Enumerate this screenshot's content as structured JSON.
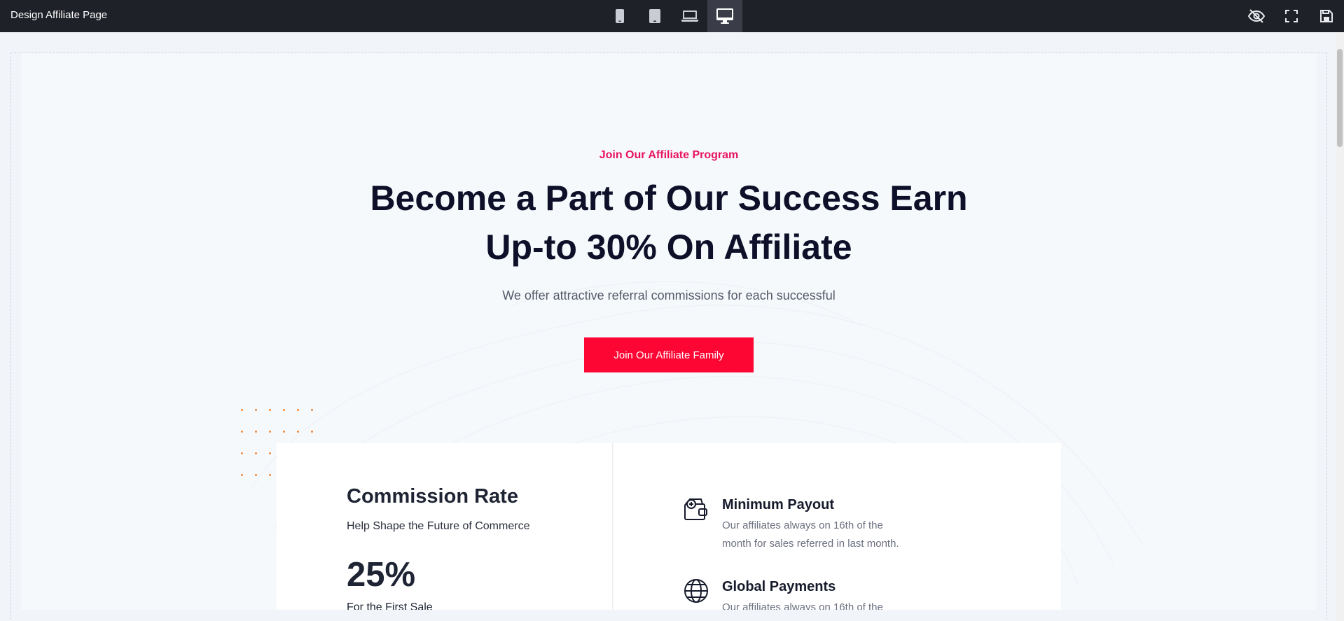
{
  "app": {
    "title": "Design Affiliate Page"
  },
  "toolbar": {
    "devices": [
      {
        "name": "mobile",
        "icon": "mobile-icon",
        "active": false
      },
      {
        "name": "tablet",
        "icon": "tablet-icon",
        "active": false
      },
      {
        "name": "laptop",
        "icon": "laptop-icon",
        "active": false
      },
      {
        "name": "desktop",
        "icon": "desktop-icon",
        "active": true
      }
    ],
    "tools": [
      "eye-off-icon",
      "fullscreen-icon",
      "save-icon"
    ]
  },
  "hero": {
    "eyebrow": "Join Our Affiliate Program",
    "headline_line1": "Become a Part of Our Success Earn",
    "headline_line2": "Up-to 30% On Affiliate",
    "subline": "We offer attractive referral commissions for each successful",
    "cta_label": "Join Our Affiliate Family"
  },
  "commission": {
    "title": "Commission Rate",
    "subtitle": "Help Shape the Future of Commerce",
    "value": "25%",
    "caption": "For the First Sale"
  },
  "features": [
    {
      "icon": "wallet-icon",
      "title": "Minimum Payout",
      "description": "Our affiliates always on 16th of the month for sales referred in last month."
    },
    {
      "icon": "globe-icon",
      "title": "Global Payments",
      "description": "Our affiliates always on 16th of the"
    }
  ],
  "colors": {
    "accent_pink": "#e8125c",
    "cta_red": "#fd0634",
    "heading": "#0d1028",
    "topbar": "#1f2128",
    "dot_orange": "#f08a3c"
  }
}
